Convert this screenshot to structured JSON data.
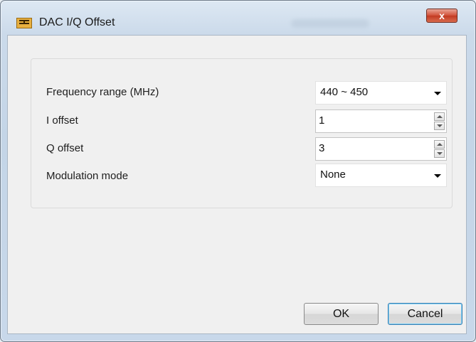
{
  "window": {
    "title": "DAC I/Q Offset",
    "icon": "app-icon",
    "close_label": "x",
    "blurred_title_text": ""
  },
  "form": {
    "frequency_range": {
      "label": "Frequency range (MHz)",
      "value": "440 ~ 450"
    },
    "i_offset": {
      "label": "I offset",
      "value": "1"
    },
    "q_offset": {
      "label": "Q offset",
      "value": "3"
    },
    "modulation_mode": {
      "label": "Modulation mode",
      "value": "None"
    }
  },
  "buttons": {
    "ok": "OK",
    "cancel": "Cancel"
  }
}
